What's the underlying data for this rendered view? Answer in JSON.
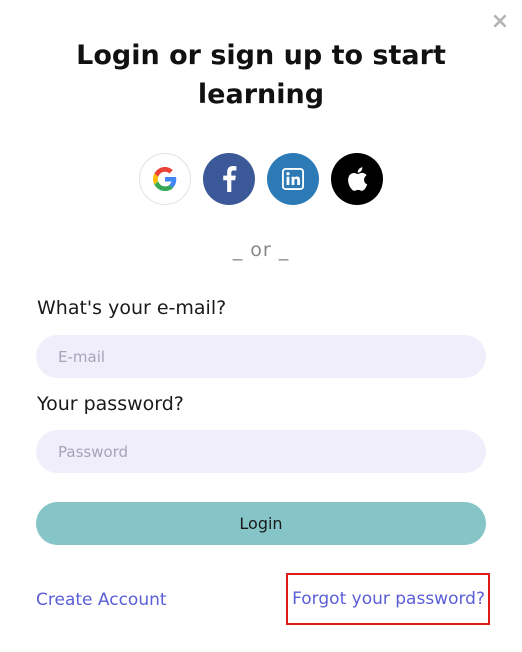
{
  "dialog": {
    "title": "Login or sign up to start learning"
  },
  "social": [
    {
      "name": "google",
      "icon": "google-icon",
      "color": "#ffffff"
    },
    {
      "name": "facebook",
      "icon": "facebook-icon",
      "color": "#3b5998"
    },
    {
      "name": "linkedin",
      "icon": "linkedin-icon",
      "color": "#2c7bb6"
    },
    {
      "name": "apple",
      "icon": "apple-icon",
      "color": "#000000"
    }
  ],
  "divider": {
    "text": "or"
  },
  "form": {
    "email_label": "What's your e-mail?",
    "email_placeholder": "E-mail",
    "email_value": "",
    "password_label": "Your password?",
    "password_placeholder": "Password",
    "password_value": "",
    "login_label": "Login"
  },
  "links": {
    "create_account": "Create Account",
    "forgot_password": "Forgot your password?"
  },
  "colors": {
    "accent_button": "#85c5c8",
    "input_bg": "#f1eefb",
    "link": "#5a5ed6",
    "highlight_box": "#e01b1b"
  }
}
